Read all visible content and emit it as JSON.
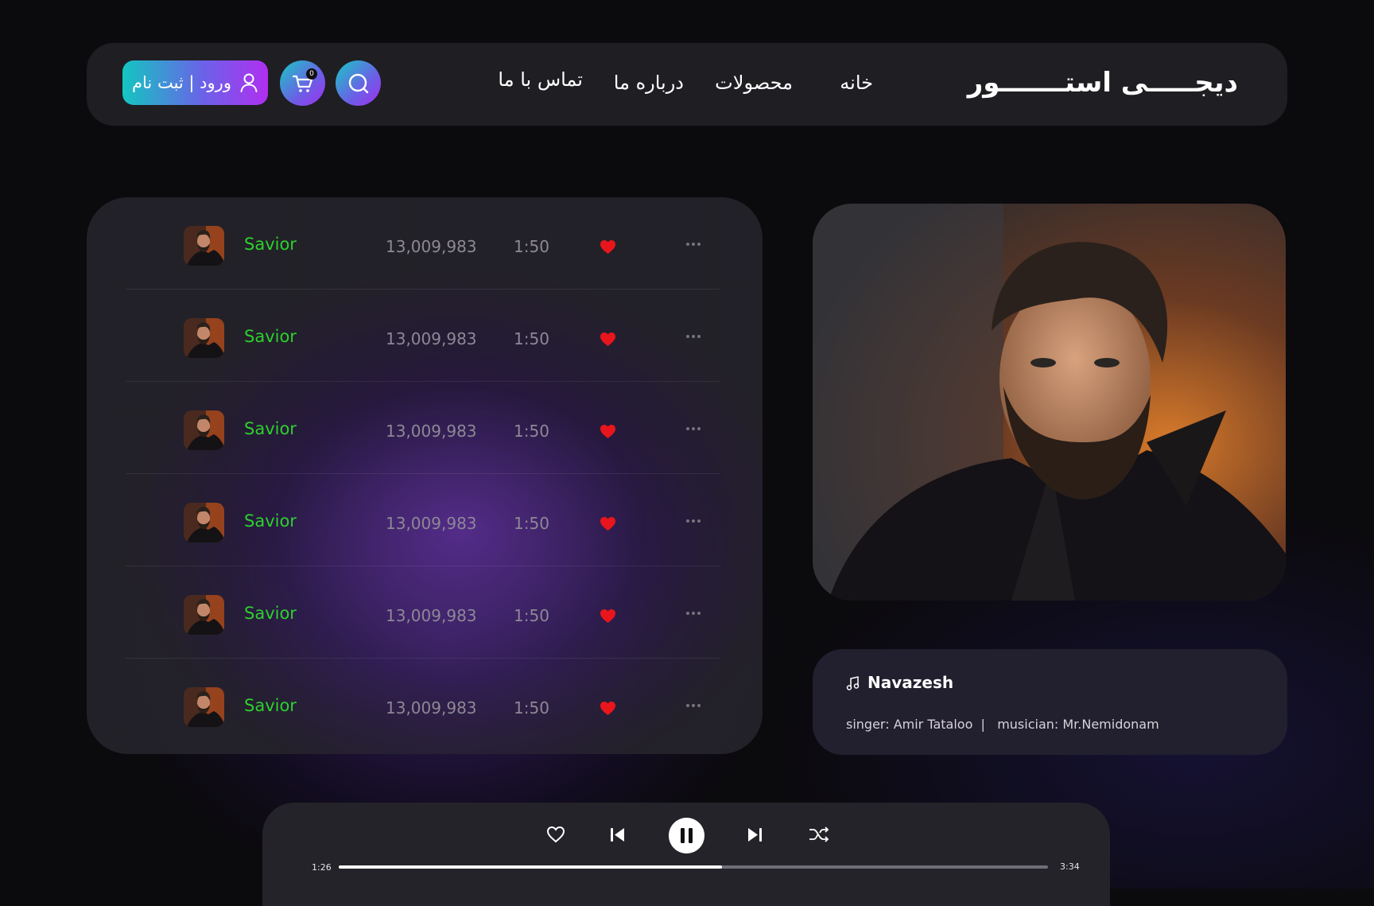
{
  "brand": {
    "logo": "دیجـــــی استـــــــور"
  },
  "nav": {
    "items": [
      "خانه",
      "محصولات",
      "درباره ما",
      "تماس با ما"
    ]
  },
  "header": {
    "login_label": "ورود | ثبت نام",
    "cart_count": "0"
  },
  "playlist": {
    "rows": [
      {
        "title": "Savior",
        "plays": "13,009,983",
        "duration": "1:50"
      },
      {
        "title": "Savior",
        "plays": "13,009,983",
        "duration": "1:50"
      },
      {
        "title": "Savior",
        "plays": "13,009,983",
        "duration": "1:50"
      },
      {
        "title": "Savior",
        "plays": "13,009,983",
        "duration": "1:50"
      },
      {
        "title": "Savior",
        "plays": "13,009,983",
        "duration": "1:50"
      },
      {
        "title": "Savior",
        "plays": "13,009,983",
        "duration": "1:50"
      }
    ]
  },
  "now_playing": {
    "title": "Navazesh",
    "credits": "singer: Amir Tataloo  |   musician: Mr.Nemidonam"
  },
  "player": {
    "elapsed": "1:26",
    "total": "3:34",
    "progress_fraction": 0.54
  },
  "colors": {
    "accent_green": "#2dd02d",
    "heart_red": "#e8161c",
    "gradient_start": "#13c6c1",
    "gradient_end": "#b02ff0"
  },
  "icons": [
    "user-icon",
    "cart-icon",
    "search-icon",
    "heart-icon",
    "more-icon",
    "music-note-icon",
    "prev-icon",
    "pause-icon",
    "next-icon",
    "shuffle-icon"
  ]
}
